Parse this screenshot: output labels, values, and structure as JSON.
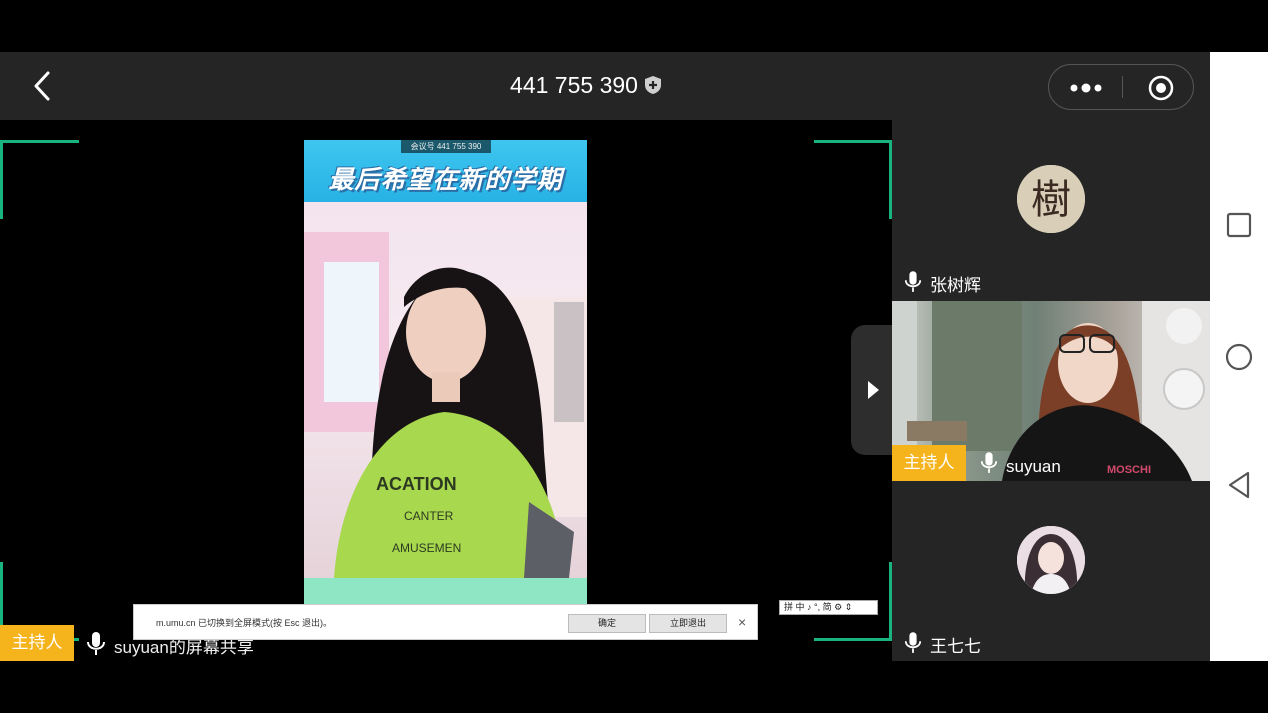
{
  "header": {
    "meeting_id": "441 755 390",
    "icons": [
      "back-chevron-icon",
      "shield-icon",
      "more-icon",
      "record-icon"
    ]
  },
  "share": {
    "meeting_overlay": "会议号 441 755 390",
    "caption": "最后希望在新的学期",
    "host_badge": "主持人",
    "label": "suyuan的屏幕共享"
  },
  "fullscreen_notice": {
    "message": "m.umu.cn 已切换到全屏模式(按 Esc 退出)。",
    "confirm_label": "确定",
    "exit_label": "立即退出",
    "close_glyph": "×"
  },
  "ime": {
    "text": "拼 中 ♪ °, 简 ⚙ ⇕"
  },
  "participants": [
    {
      "name": "张树辉",
      "host": false,
      "video": false,
      "avatar_char": "樹"
    },
    {
      "name": "suyuan",
      "host": true,
      "host_label": "主持人",
      "video": true
    },
    {
      "name": "王七七",
      "host": false,
      "video": false
    }
  ],
  "colors": {
    "accent_green": "#19b47d",
    "host_orange": "#f5b31c",
    "panel_bg": "#252525"
  }
}
